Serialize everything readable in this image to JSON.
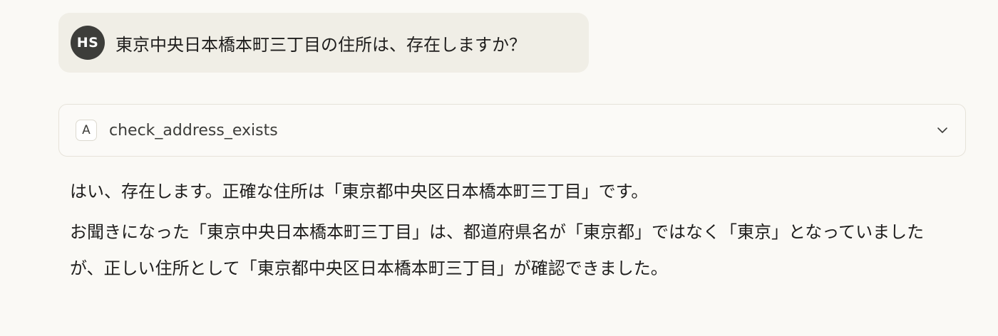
{
  "user_message": {
    "avatar_initials": "HS",
    "text": "東京中央日本橋本町三丁目の住所は、存在しますか？"
  },
  "tool_call": {
    "icon_letter": "A",
    "name": "check_address_exists",
    "icon": "chevron-down-icon"
  },
  "response": {
    "paragraph_1": "はい、存在します。正確な住所は「東京都中央区日本橋本町三丁目」です。",
    "paragraph_2": "お聞きになった「東京中央日本橋本町三丁目」は、都道府県名が「東京都」ではなく「東京」となっていましたが、正しい住所として「東京都中央区日本橋本町三丁目」が確認できました。"
  },
  "colors": {
    "background": "#faf9f5",
    "user_bubble": "#f0eee6",
    "avatar": "#3d3d3a",
    "card_border": "#e6e3da"
  }
}
